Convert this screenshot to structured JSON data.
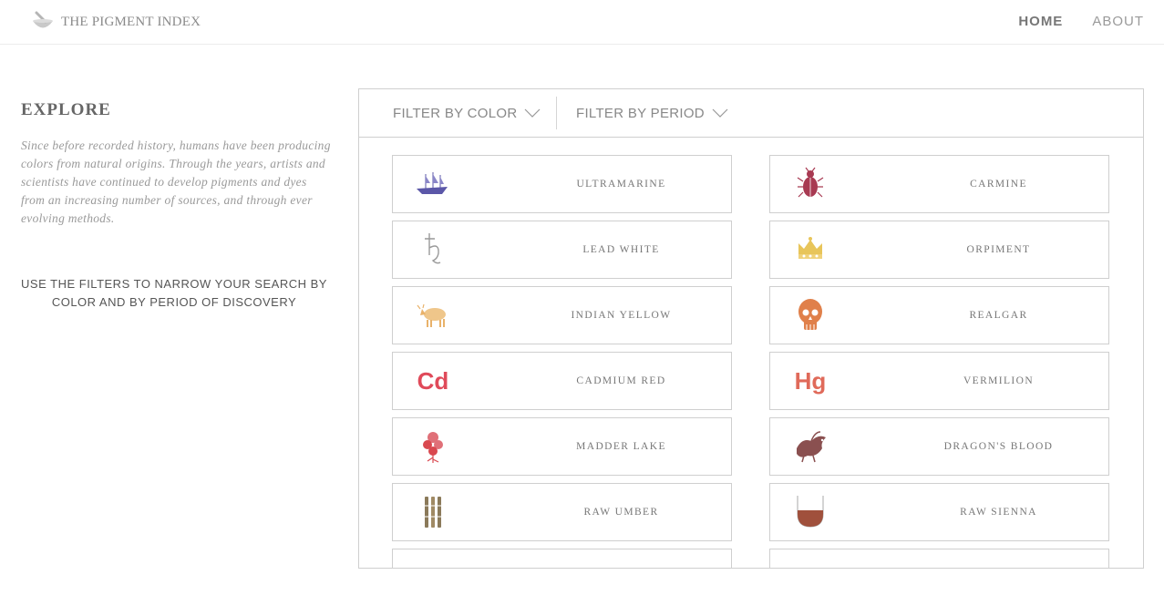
{
  "header": {
    "logo_text": "THE PIGMENT INDEX",
    "nav": {
      "home": "HOME",
      "about": "ABOUT"
    }
  },
  "explore": {
    "title": "EXPLORE",
    "description": "Since before recorded history, humans have been producing colors from natural origins. Through the years, artists and scientists have continued to develop pigments and dyes from an increasing number of sources, and through ever evolving methods.",
    "hint_line1": "USE THE FILTERS TO NARROW YOUR SEARCH BY",
    "hint_line2": "COLOR AND BY PERIOD OF DISCOVERY"
  },
  "filters": {
    "color_label": "FILTER BY COLOR",
    "period_label": "FILTER BY PERIOD"
  },
  "pigments": [
    {
      "name": "ULTRAMARINE",
      "icon": "ship-icon",
      "color": "#5b57a8"
    },
    {
      "name": "CARMINE",
      "icon": "beetle-icon",
      "color": "#a83a52"
    },
    {
      "name": "LEAD WHITE",
      "icon": "saturn-symbol-icon",
      "color": "#999999"
    },
    {
      "name": "ORPIMENT",
      "icon": "crown-icon",
      "color": "#e8c55a"
    },
    {
      "name": "INDIAN YELLOW",
      "icon": "cow-icon",
      "color": "#e9b26a"
    },
    {
      "name": "REALGAR",
      "icon": "skull-icon",
      "color": "#e0804a"
    },
    {
      "name": "CADMIUM RED",
      "icon": "cd-element-icon",
      "symbol": "Cd",
      "color": "#e04a5a"
    },
    {
      "name": "VERMILION",
      "icon": "hg-element-icon",
      "symbol": "Hg",
      "color": "#e06a5a"
    },
    {
      "name": "MADDER LAKE",
      "icon": "madder-flower-icon",
      "color": "#d9484f"
    },
    {
      "name": "DRAGON'S BLOOD",
      "icon": "dragon-icon",
      "color": "#8a5050"
    },
    {
      "name": "RAW UMBER",
      "icon": "brushes-icon",
      "color": "#8b7a5a"
    },
    {
      "name": "RAW SIENNA",
      "icon": "cup-icon",
      "color": "#a0503c"
    },
    {
      "name": "",
      "icon": "partial-icon",
      "color": "#999999"
    },
    {
      "name": "",
      "icon": "partial-blue-icon",
      "color": "#4a5aa8"
    }
  ]
}
